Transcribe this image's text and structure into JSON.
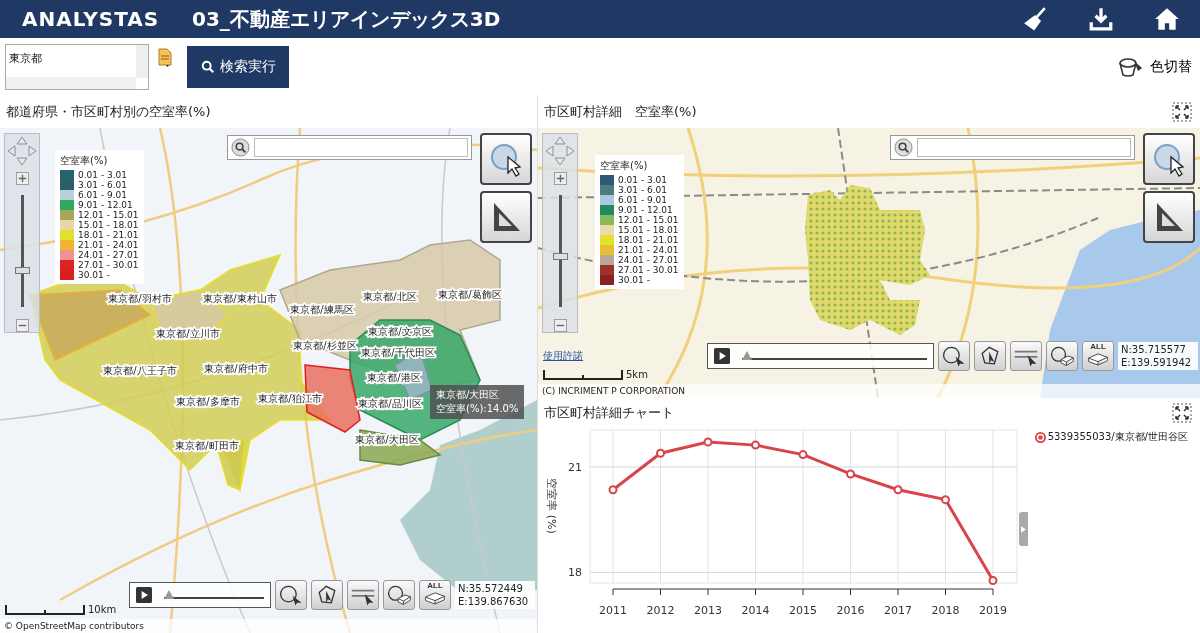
{
  "header": {
    "logo": "ANALYSTAS",
    "title": "03_不動産エリアインデックス3D"
  },
  "search": {
    "list_items": [
      "東京都"
    ],
    "button": "検索実行",
    "color_toggle": "色切替"
  },
  "left_panel": {
    "title": "都道府県・市区町村別の空室率(%)",
    "map": {
      "legend": {
        "title": "空室率(%)",
        "items": [
          {
            "range": "0.01 - 3.01",
            "color": "#25646c"
          },
          {
            "range": "3.01 - 6.01",
            "color": "#2a5f6a"
          },
          {
            "range": "6.01 - 9.01",
            "color": "#b9d0da"
          },
          {
            "range": "9.01 - 12.01",
            "color": "#2fa862"
          },
          {
            "range": "12.01 - 15.01",
            "color": "#a6a65c"
          },
          {
            "range": "15.01 - 18.01",
            "color": "#ead5a8"
          },
          {
            "range": "18.01 - 21.01",
            "color": "#e3df2e"
          },
          {
            "range": "21.01 - 24.01",
            "color": "#f0b432"
          },
          {
            "range": "24.01 - 27.01",
            "color": "#ee9292"
          },
          {
            "range": "27.01 - 30.01",
            "color": "#dc2222"
          },
          {
            "range": "30.01 -",
            "color": "#d81f1f"
          }
        ]
      },
      "zoom": {
        "level": 0.32
      },
      "regions": [
        "東京都/羽村市",
        "東京都/東村山市",
        "東京都/練馬区",
        "東京都/北区",
        "東京都/葛飾区",
        "東京都/立川市",
        "東京都/文京区",
        "東京都/杉並区",
        "東京都/千代田区",
        "東京都/八王子市",
        "東京都/府中市",
        "東京都/港区",
        "東京都/多摩市",
        "東京都/狛江市",
        "東京都/品川区",
        "東京都/町田市",
        "東京都/大田区"
      ],
      "tooltip": {
        "name": "東京都/大田区",
        "value": "空室率(%):14.0%"
      },
      "time_slider": {
        "level": 0
      },
      "all_button": "ALL",
      "coordinates": [
        "N:35.572449",
        "E:139.867630"
      ],
      "scale": "10km",
      "attribution": "© OpenStreetMap contributors"
    }
  },
  "right_panel": {
    "title": "市区町村詳細　空室率(%)",
    "map": {
      "legend": {
        "title": "空室率(%)",
        "items": [
          {
            "range": "0.01 - 3.01",
            "color": "#2c5b78"
          },
          {
            "range": "3.01 - 6.01",
            "color": "#4d7b80"
          },
          {
            "range": "6.01 - 9.01",
            "color": "#a9c9e2"
          },
          {
            "range": "9.01 - 12.01",
            "color": "#1d8a60"
          },
          {
            "range": "12.01 - 15.01",
            "color": "#8bb858"
          },
          {
            "range": "15.01 - 18.01",
            "color": "#e9dca8"
          },
          {
            "range": "18.01 - 21.01",
            "color": "#e4e02e"
          },
          {
            "range": "21.01 - 24.01",
            "color": "#e6c030"
          },
          {
            "range": "24.01 - 27.01",
            "color": "#b8a898"
          },
          {
            "range": "27.01 - 30.01",
            "color": "#a03030"
          },
          {
            "range": "30.01 -",
            "color": "#8a2020"
          }
        ]
      },
      "zoom": {
        "level": 0.45
      },
      "license_link": "使用許諾",
      "time_slider": {
        "level": 0
      },
      "all_button": "ALL",
      "coordinates": [
        "N:35.715577",
        "E:139.591942"
      ],
      "scale": "5km",
      "attribution": "(C) INCRIMENT P CORPORATION"
    },
    "chart_title": "市区町村詳細チャート",
    "chart_data": {
      "type": "line",
      "ylabel": "空室率 (%)",
      "categories": [
        "2011",
        "2012",
        "2013",
        "2014",
        "2015",
        "2016",
        "2017",
        "2018",
        "2019"
      ],
      "series": [
        {
          "name": "5339355033/東京都/世田谷区",
          "color": "#d9434a",
          "marker": true,
          "values": [
            20.35,
            21.39,
            21.71,
            21.62,
            21.35,
            20.8,
            20.35,
            20.07,
            17.77
          ]
        }
      ],
      "ylim": [
        17.7,
        22.05
      ],
      "yticks": [
        18,
        21
      ],
      "grid": true
    }
  }
}
